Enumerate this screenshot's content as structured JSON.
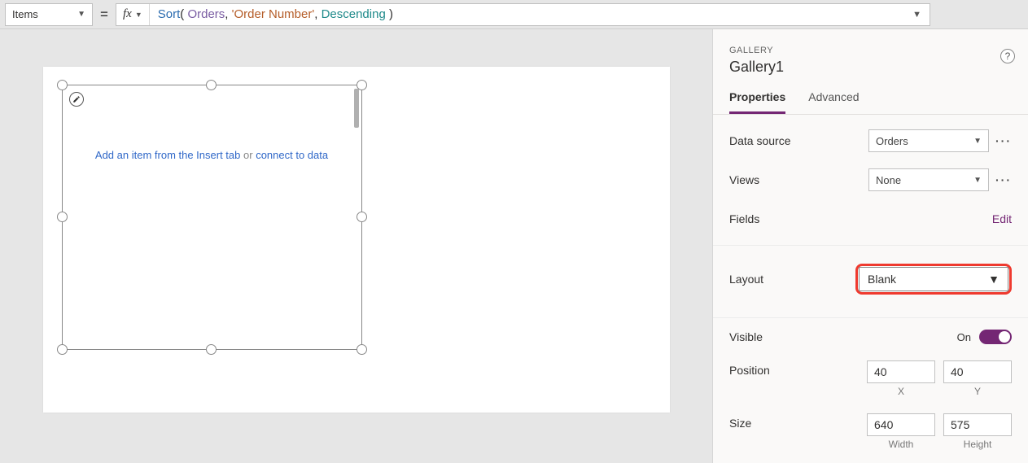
{
  "formula_bar": {
    "property": "Items",
    "fx_label": "fx",
    "tokens": {
      "fn": "Sort",
      "open": "( ",
      "table": "Orders",
      "comma1": ", ",
      "col": "'Order Number'",
      "comma2": ", ",
      "enum": "Descending",
      "close": " )"
    }
  },
  "canvas": {
    "hint_link1": "Add an item from the Insert tab",
    "hint_mid": " or ",
    "hint_link2": "connect to data"
  },
  "panel": {
    "type_label": "GALLERY",
    "name": "Gallery1",
    "tabs": {
      "properties": "Properties",
      "advanced": "Advanced"
    },
    "rows": {
      "data_source": {
        "label": "Data source",
        "value": "Orders"
      },
      "views": {
        "label": "Views",
        "value": "None"
      },
      "fields": {
        "label": "Fields",
        "action": "Edit"
      },
      "layout": {
        "label": "Layout",
        "value": "Blank"
      },
      "visible": {
        "label": "Visible",
        "state": "On"
      },
      "position": {
        "label": "Position",
        "x": "40",
        "y": "40",
        "xl": "X",
        "yl": "Y"
      },
      "size": {
        "label": "Size",
        "w": "640",
        "h": "575",
        "wl": "Width",
        "hl": "Height"
      }
    }
  }
}
